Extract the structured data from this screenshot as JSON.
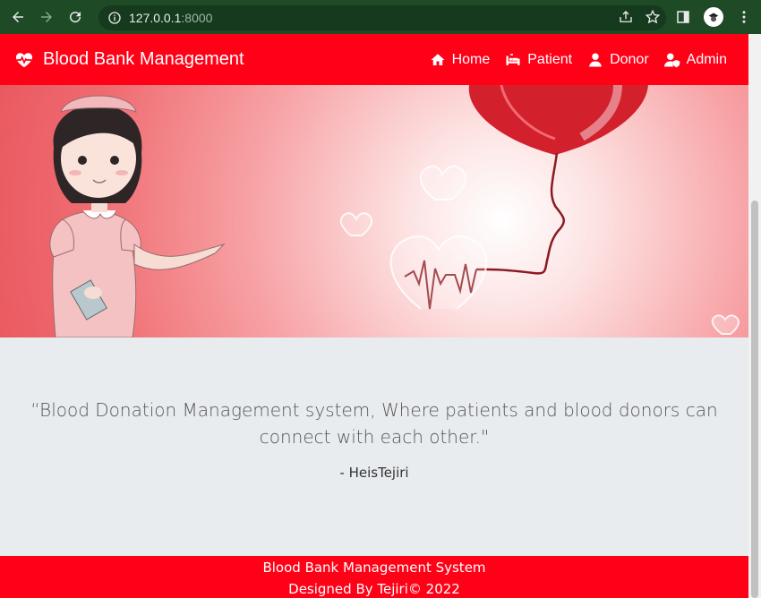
{
  "browser": {
    "url_host": "127.0.0.1",
    "url_port": ":8000",
    "icons": [
      "back-icon",
      "forward-icon",
      "reload-icon",
      "info-icon",
      "share-icon",
      "star-icon",
      "sidebar-icon",
      "profile-avatar",
      "more-icon"
    ]
  },
  "navbar": {
    "brand": "Blood Bank Management",
    "brand_icon": "heartbeat-icon",
    "items": [
      {
        "label": "Home",
        "icon": "home-icon"
      },
      {
        "label": "Patient",
        "icon": "bed-icon"
      },
      {
        "label": "Donor",
        "icon": "user-icon"
      },
      {
        "label": "Admin",
        "icon": "user-shield-icon"
      }
    ],
    "color": "#ff0017"
  },
  "quote": {
    "text": "“Blood Donation Management system, Where patients and blood donors can connect with each other.\"",
    "author": "- HeisTejiri"
  },
  "footer": {
    "line1": "Blood Bank Management System",
    "line2": "Designed By Tejiri© 2022"
  }
}
